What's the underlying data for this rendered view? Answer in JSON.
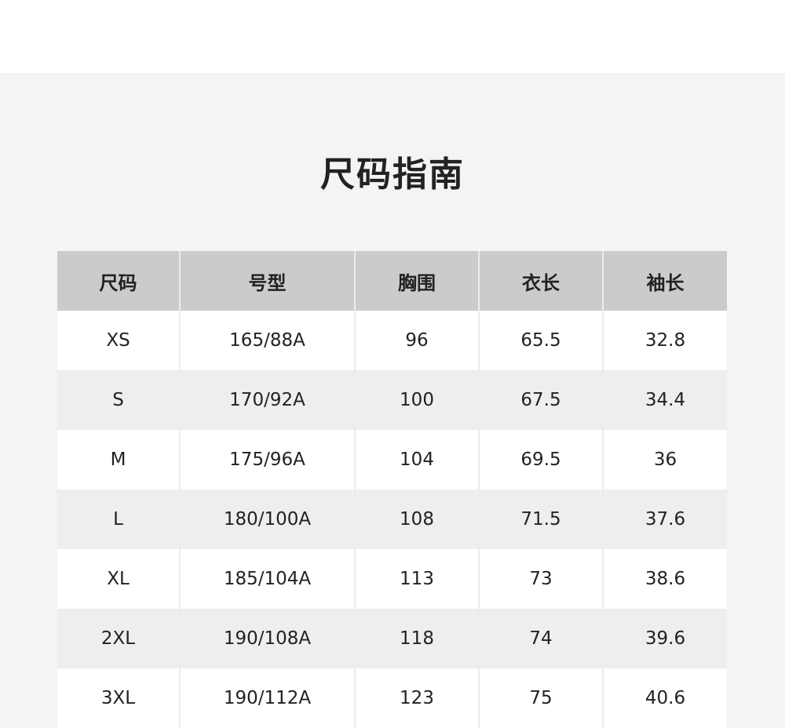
{
  "title": "尺码指南",
  "table": {
    "headers": [
      "尺码",
      "号型",
      "胸围",
      "衣长",
      "袖长"
    ],
    "rows": [
      [
        "XS",
        "165/88A",
        "96",
        "65.5",
        "32.8"
      ],
      [
        "S",
        "170/92A",
        "100",
        "67.5",
        "34.4"
      ],
      [
        "M",
        "175/96A",
        "104",
        "69.5",
        "36"
      ],
      [
        "L",
        "180/100A",
        "108",
        "71.5",
        "37.6"
      ],
      [
        "XL",
        "185/104A",
        "113",
        "73",
        "38.6"
      ],
      [
        "2XL",
        "190/108A",
        "118",
        "74",
        "39.6"
      ],
      [
        "3XL",
        "190/112A",
        "123",
        "75",
        "40.6"
      ]
    ]
  }
}
